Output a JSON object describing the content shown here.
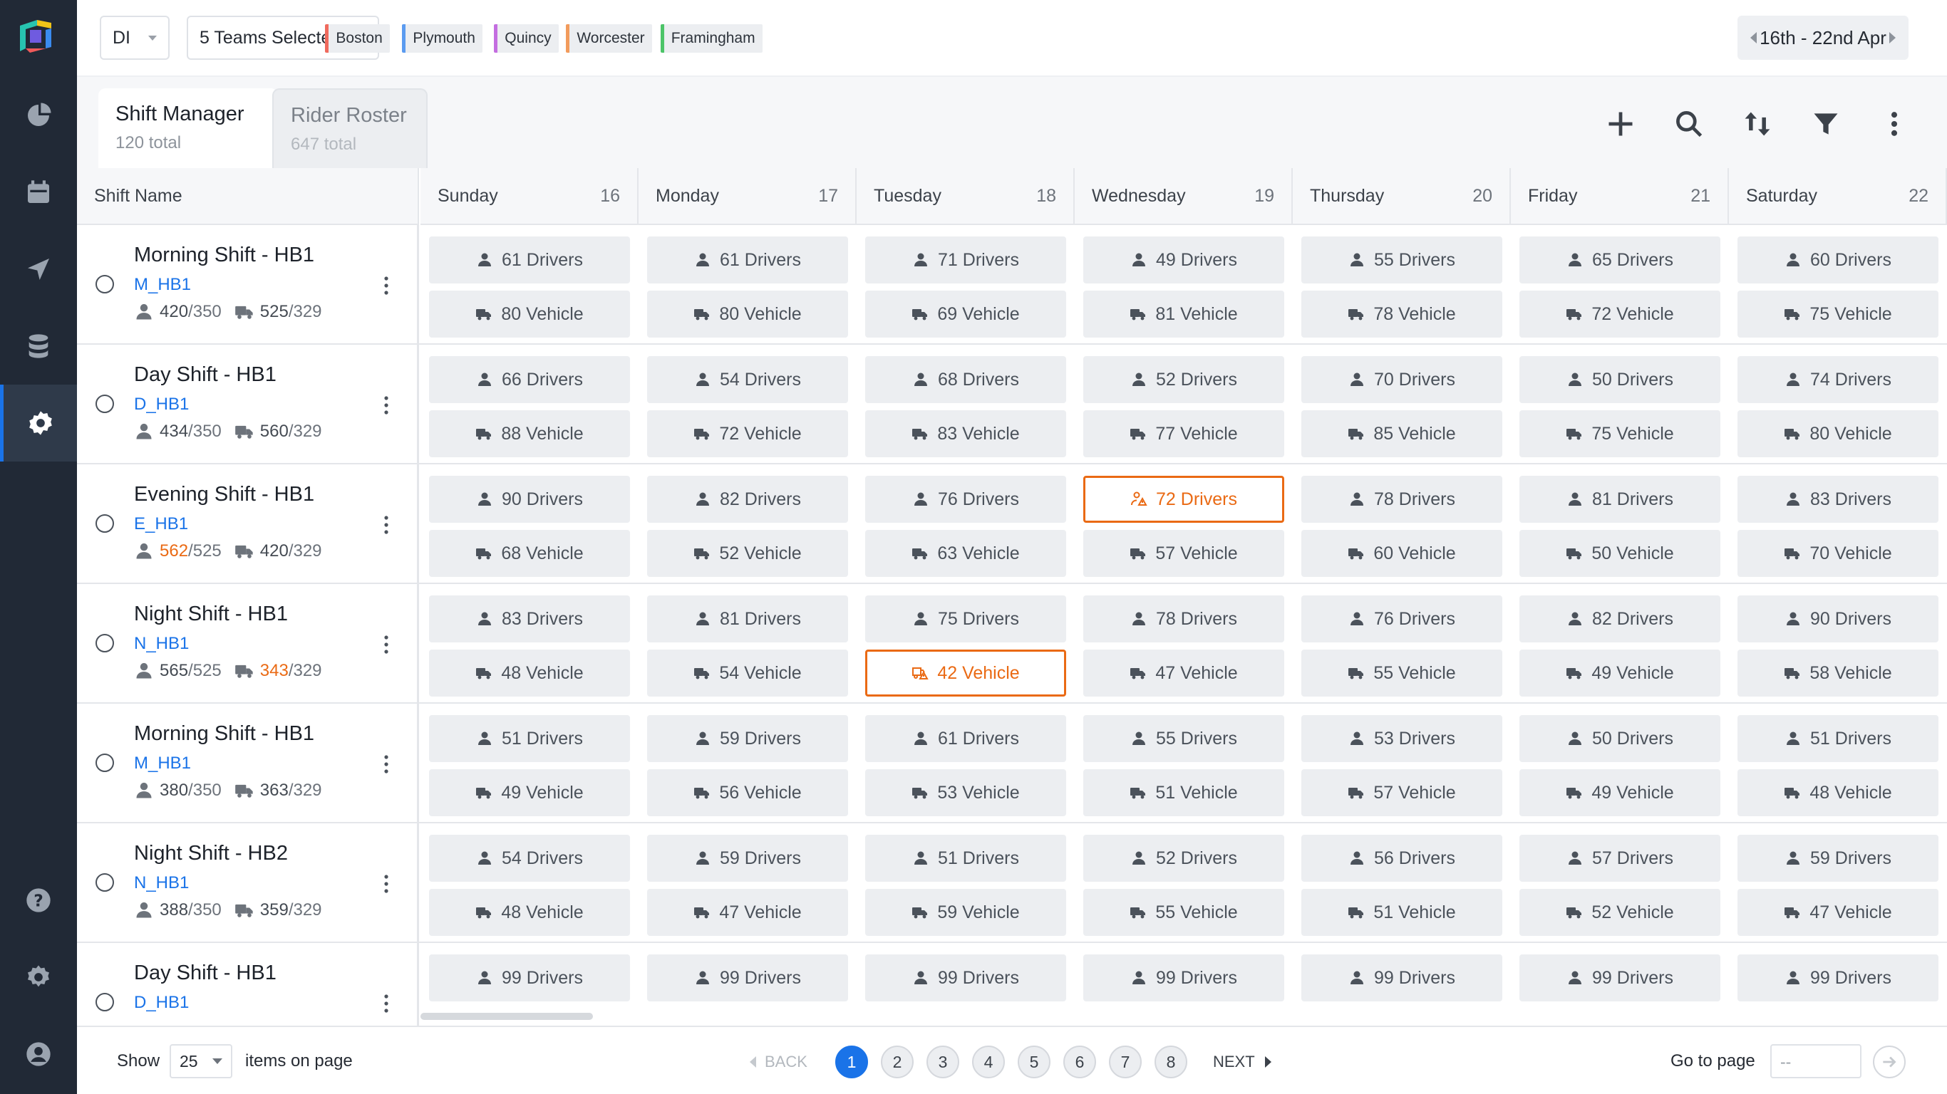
{
  "filters": {
    "division": "DI",
    "teams_label": "5 Teams Selected",
    "teams": [
      {
        "label": "Boston",
        "color": "#f06b5e"
      },
      {
        "label": "Plymouth",
        "color": "#5b9bf0"
      },
      {
        "label": "Quincy",
        "color": "#c46ee0"
      },
      {
        "label": "Worcester",
        "color": "#f29b5c"
      },
      {
        "label": "Framingham",
        "color": "#4cc468"
      }
    ]
  },
  "date_range": "16th - 22nd Apr",
  "tabs": [
    {
      "title": "Shift Manager",
      "count": "120 total"
    },
    {
      "title": "Rider Roster",
      "count": "647 total"
    }
  ],
  "columns": {
    "shift_name": "Shift Name",
    "days": [
      {
        "name": "Sunday",
        "date": "16"
      },
      {
        "name": "Monday",
        "date": "17"
      },
      {
        "name": "Tuesday",
        "date": "18"
      },
      {
        "name": "Wednesday",
        "date": "19"
      },
      {
        "name": "Thursday",
        "date": "20"
      },
      {
        "name": "Friday",
        "date": "21"
      },
      {
        "name": "Saturday",
        "date": "22"
      }
    ]
  },
  "rows": [
    {
      "name": "Morning Shift - HB1",
      "code": "M_HB1",
      "drivers_cur": "420",
      "drivers_cap": "/350",
      "vehicles_cur": "525",
      "vehicles_cap": "/329",
      "drivers_warn": false,
      "vehicles_warn": false,
      "drivers": [
        "61 Drivers",
        "61 Drivers",
        "71 Drivers",
        "49 Drivers",
        "55 Drivers",
        "65 Drivers",
        "60 Drivers"
      ],
      "vehicles": [
        "80 Vehicle",
        "80 Vehicle",
        "69 Vehicle",
        "81 Vehicle",
        "78 Vehicle",
        "72 Vehicle",
        "75 Vehicle"
      ]
    },
    {
      "name": "Day Shift - HB1",
      "code": "D_HB1",
      "drivers_cur": "434",
      "drivers_cap": "/350",
      "vehicles_cur": "560",
      "vehicles_cap": "/329",
      "drivers_warn": false,
      "vehicles_warn": false,
      "drivers": [
        "66 Drivers",
        "54 Drivers",
        "68 Drivers",
        "52 Drivers",
        "70 Drivers",
        "50 Drivers",
        "74 Drivers"
      ],
      "vehicles": [
        "88 Vehicle",
        "72 Vehicle",
        "83 Vehicle",
        "77 Vehicle",
        "85 Vehicle",
        "75 Vehicle",
        "80 Vehicle"
      ]
    },
    {
      "name": "Evening Shift - HB1",
      "code": "E_HB1",
      "drivers_cur": "562",
      "drivers_cap": "/525",
      "vehicles_cur": "420",
      "vehicles_cap": "/329",
      "drivers_warn": true,
      "vehicles_warn": false,
      "drivers": [
        "90 Drivers",
        "82 Drivers",
        "76 Drivers",
        "72 Drivers",
        "78 Drivers",
        "81 Drivers",
        "83 Drivers"
      ],
      "vehicles": [
        "68 Vehicle",
        "52 Vehicle",
        "63 Vehicle",
        "57 Vehicle",
        "60 Vehicle",
        "50 Vehicle",
        "70 Vehicle"
      ],
      "driver_alert_day": 3
    },
    {
      "name": "Night Shift - HB1",
      "code": "N_HB1",
      "drivers_cur": "565",
      "drivers_cap": "/525",
      "vehicles_cur": "343",
      "vehicles_cap": "/329",
      "drivers_warn": false,
      "vehicles_warn": true,
      "drivers": [
        "83 Drivers",
        "81 Drivers",
        "75 Drivers",
        "78 Drivers",
        "76 Drivers",
        "82 Drivers",
        "90 Drivers"
      ],
      "vehicles": [
        "48 Vehicle",
        "54 Vehicle",
        "42 Vehicle",
        "47 Vehicle",
        "55 Vehicle",
        "49 Vehicle",
        "58 Vehicle"
      ],
      "vehicle_alert_day": 2
    },
    {
      "name": "Morning Shift - HB1",
      "code": "M_HB1",
      "drivers_cur": "380",
      "drivers_cap": "/350",
      "vehicles_cur": "363",
      "vehicles_cap": "/329",
      "drivers_warn": false,
      "vehicles_warn": false,
      "drivers": [
        "51 Drivers",
        "59 Drivers",
        "61 Drivers",
        "55 Drivers",
        "53 Drivers",
        "50 Drivers",
        "51 Drivers"
      ],
      "vehicles": [
        "49 Vehicle",
        "56 Vehicle",
        "53 Vehicle",
        "51 Vehicle",
        "57 Vehicle",
        "49 Vehicle",
        "48 Vehicle"
      ]
    },
    {
      "name": "Night Shift - HB2",
      "code": "N_HB1",
      "drivers_cur": "388",
      "drivers_cap": "/350",
      "vehicles_cur": "359",
      "vehicles_cap": "/329",
      "drivers_warn": false,
      "vehicles_warn": false,
      "drivers": [
        "54 Drivers",
        "59 Drivers",
        "51 Drivers",
        "52 Drivers",
        "56 Drivers",
        "57 Drivers",
        "59 Drivers"
      ],
      "vehicles": [
        "48 Vehicle",
        "47 Vehicle",
        "59 Vehicle",
        "55 Vehicle",
        "51 Vehicle",
        "52 Vehicle",
        "47 Vehicle"
      ]
    },
    {
      "name": "Day Shift - HB1",
      "code": "D_HB1",
      "drivers_cur": "",
      "drivers_cap": "",
      "vehicles_cur": "",
      "vehicles_cap": "",
      "drivers_warn": false,
      "vehicles_warn": false,
      "drivers": [
        "99 Drivers",
        "99 Drivers",
        "99 Drivers",
        "99 Drivers",
        "99 Drivers",
        "99 Drivers",
        "99 Drivers"
      ],
      "vehicles": []
    }
  ],
  "footer": {
    "show": "Show",
    "page_size": "25",
    "items_on_page": "items on page",
    "back": "BACK",
    "next": "NEXT",
    "pages": [
      "1",
      "2",
      "3",
      "4",
      "5",
      "6",
      "7",
      "8"
    ],
    "current_page": "1",
    "goto": "Go to page",
    "goto_placeholder": "--"
  },
  "colors": {
    "accent": "#1a73e8",
    "warning": "#ea6a14",
    "sidebar": "#212936"
  }
}
